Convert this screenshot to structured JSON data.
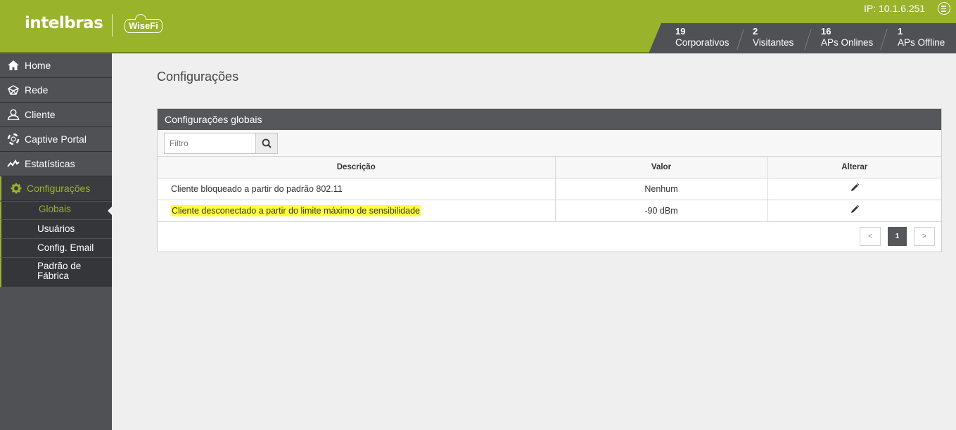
{
  "header": {
    "logo": "intelbras",
    "product": "WiseFi",
    "ip": "IP: 10.1.6.251",
    "stats": [
      {
        "value": "19",
        "label": "Corporativos"
      },
      {
        "value": "2",
        "label": "Visitantes"
      },
      {
        "value": "16",
        "label": "APs Onlines"
      },
      {
        "value": "1",
        "label": "APs Offline"
      }
    ]
  },
  "sidebar": {
    "items": [
      {
        "label": "Home",
        "icon": "home-icon"
      },
      {
        "label": "Rede",
        "icon": "network-icon"
      },
      {
        "label": "Cliente",
        "icon": "user-icon"
      },
      {
        "label": "Captive Portal",
        "icon": "lifebuoy-icon"
      },
      {
        "label": "Estatísticas",
        "icon": "chart-line-icon"
      },
      {
        "label": "Configurações",
        "icon": "gear-icon"
      }
    ],
    "subitems": [
      {
        "label": "Globais"
      },
      {
        "label": "Usuários"
      },
      {
        "label": "Config. Email"
      },
      {
        "label": "Padrão de Fábrica"
      }
    ]
  },
  "main": {
    "title": "Configurações",
    "panel_title": "Configurações globais",
    "filter_placeholder": "Filtro",
    "columns": [
      "Descrição",
      "Valor",
      "Alterar"
    ],
    "rows": [
      {
        "description": "Cliente bloqueado a partir do padrão 802.11",
        "value": "Nenhum"
      },
      {
        "description": "Cliente desconectado a partir do limite máximo de sensibilidade",
        "value": "-90 dBm"
      }
    ],
    "pagination": {
      "prev": "<",
      "current": "1",
      "next": ">"
    }
  },
  "colors": {
    "brand_green": "#99b32a",
    "dark_gray": "#4f5154",
    "highlight": "#ffff3b"
  }
}
